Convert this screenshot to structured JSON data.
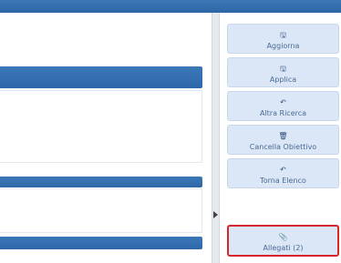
{
  "right_panel": {
    "buttons": [
      {
        "label": "Aggiorna",
        "icon": "save-icon"
      },
      {
        "label": "Applica",
        "icon": "save-icon"
      },
      {
        "label": "Altra Ricerca",
        "icon": "undo-icon"
      },
      {
        "label": "Cancella Obiettivo",
        "icon": "trash-icon"
      },
      {
        "label": "Torna Elenco",
        "icon": "undo-icon"
      },
      {
        "label": "Allegati (2)",
        "icon": "paperclip-icon",
        "highlighted": true
      }
    ]
  },
  "colors": {
    "header_blue": "#2d66a6",
    "button_bg": "#dbe7f6",
    "highlight_red": "#d7262a"
  }
}
